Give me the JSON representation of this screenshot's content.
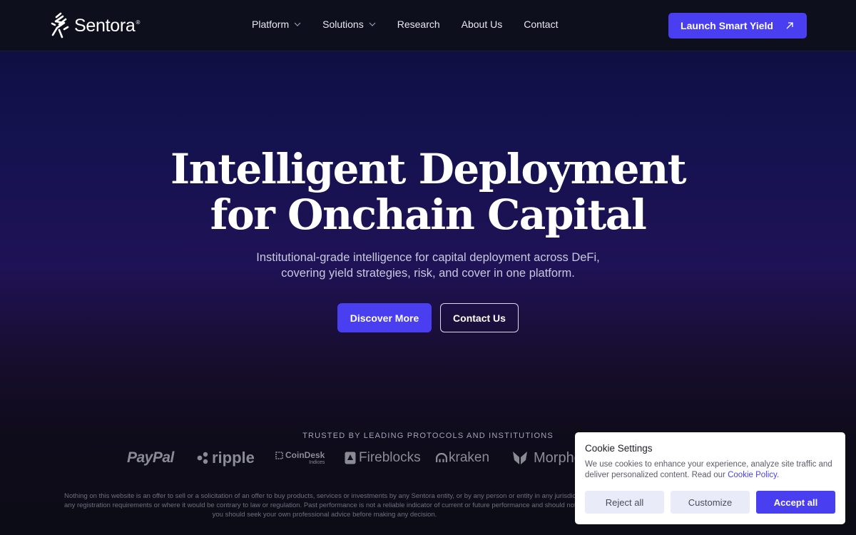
{
  "nav": {
    "brand": "Sentora",
    "brand_mark": "®",
    "links": [
      {
        "label": "Platform",
        "has_dropdown": true
      },
      {
        "label": "Solutions",
        "has_dropdown": true
      },
      {
        "label": "Research",
        "has_dropdown": false
      },
      {
        "label": "About Us",
        "has_dropdown": false
      },
      {
        "label": "Contact",
        "has_dropdown": false
      }
    ],
    "cta_label": "Launch Smart Yield",
    "cta_icon": "arrow-up-right-icon"
  },
  "hero": {
    "title_line1": "Intelligent Deployment",
    "title_line2": "for Onchain Capital",
    "subtitle_line1": "Institutional-grade intelligence for capital deployment across DeFi,",
    "subtitle_line2": "covering yield strategies, risk, and cover in one platform.",
    "primary_label": "Discover More",
    "secondary_label": "Contact Us"
  },
  "trusted": {
    "label": "TRUSTED BY LEADING PROTOCOLS AND INSTITUTIONS",
    "logos": {
      "paypal": "PayPal",
      "ripple": "ripple",
      "coindesk": "CoinDesk",
      "coindesk_sub": "Indices",
      "fireblocks": "Fireblocks",
      "kraken": "kraken",
      "morpho": "Morpho"
    }
  },
  "disclaimer": {
    "line1": "Nothing on this website is an offer to sell or a solicitation of an offer to buy products, services or investments by any Sentora entity, or by any person or entity in any jurisdiction where such offer or solicitation would be contrary to law or regulation or would be subject to",
    "line2": "any registration requirements or where it would be contrary to law or regulation. Past performance is not a reliable indicator of current or future performance and should not be relied upon as such. Investing involves risk; before making any investment decision",
    "line3": "you should seek your own professional advice before making any decision."
  },
  "cookie": {
    "title": "Cookie Settings",
    "text": "We use cookies to enhance your experience, analyze site traffic and deliver personalized content. Read our",
    "link_label": "Cookie Policy",
    "link_suffix": ".",
    "reject_label": "Reject all",
    "customize_label": "Customize",
    "accept_label": "Accept all"
  },
  "colors": {
    "accent": "#4a3ff0",
    "nav_bg": "#0e0f1d",
    "hero_top": "#14124f",
    "hero_mid": "#1f1256",
    "cookie_btn_bg": "#e9ecf8"
  }
}
